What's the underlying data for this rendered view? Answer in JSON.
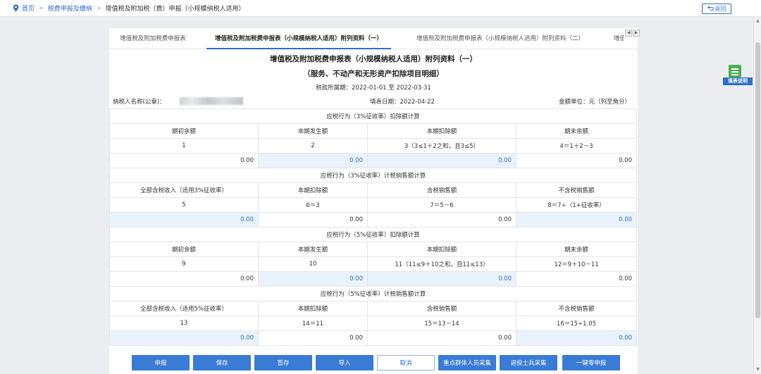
{
  "breadcrumb": {
    "home": "首页",
    "level1": "税费申报及缴纳",
    "current": "增值税及附加税（费）申报（小规模纳税人适用）"
  },
  "back_label": "返回",
  "tabs": [
    {
      "label": "增值税及附加税费申报表"
    },
    {
      "label": "增值税及附加税费申报表（小规模纳税人适用）附列资料（一）"
    },
    {
      "label": "增值税及附加税费申报表（小规模纳税人适用）附列资料（二）"
    },
    {
      "label": "增值"
    }
  ],
  "title1": "增值税及附加税费申报表（小规模纳税人适用）附列资料（一）",
  "title2": "（服务、不动产和无形资产扣除项目明细）",
  "period": "税款所属期：2022-01-01 至 2022-03-31",
  "taxpayer_label": "纳税人名称(公章)：",
  "fill_date": "填表日期：2022-04-22",
  "unit": "金额单位：元（列至角分）",
  "sections": [
    {
      "title": "应税行为（3%征收率）扣除额计算",
      "headers": [
        "期初余额",
        "本期发生额",
        "本期扣除额",
        "期末余额"
      ],
      "row_nums": [
        "1",
        "2",
        "3（3≤1＋2之和，且3≤5）",
        "4＝1＋2－3"
      ],
      "values": [
        "0.00",
        "0.00",
        "0.00",
        "0.00"
      ]
    },
    {
      "title": "应税行为（3%征收率）计税销售额计算",
      "headers": [
        "全部含税收入（适用3%征收率）",
        "本期扣除额",
        "含税销售额",
        "不含税销售额"
      ],
      "row_nums": [
        "5",
        "6＝3",
        "7＝5－6",
        "8＝7÷（1+征收率）"
      ],
      "values": [
        "0.00",
        "0.00",
        "0.00",
        "0.00"
      ]
    },
    {
      "title": "应税行为（5%征收率）扣除额计算",
      "headers": [
        "期初余额",
        "本期发生额",
        "本期扣除额",
        "期末余额"
      ],
      "row_nums": [
        "9",
        "10",
        "11（11≤9＋10之和，且11≤13）",
        "12＝9＋10－11"
      ],
      "values": [
        "0.00",
        "0.00",
        "0.00",
        "0.00"
      ]
    },
    {
      "title": "应税行为（5%征收率）计税销售额计算",
      "headers": [
        "全部含税收入（适用5%征收率）",
        "本期扣除额",
        "含税销售额",
        "不含税销售额"
      ],
      "row_nums": [
        "13",
        "14＝11",
        "15＝13－14",
        "16＝15÷1.05"
      ],
      "values": [
        "0.00",
        "0.00",
        "0.00",
        "0.00"
      ]
    }
  ],
  "buttons": {
    "declare": "申报",
    "save": "保存",
    "temp_save": "暂存",
    "import": "导入",
    "cancel": "取消",
    "key_group": "重点群体人员采集",
    "veteran": "退役士兵采集",
    "zero_declare": "一键零申报"
  },
  "help_label": "填表说明",
  "colors": {
    "accent": "#2d6fc9",
    "button": "#3a7bd5",
    "editable_cell": "#eaf2fb",
    "help_icon": "#4caf50"
  }
}
